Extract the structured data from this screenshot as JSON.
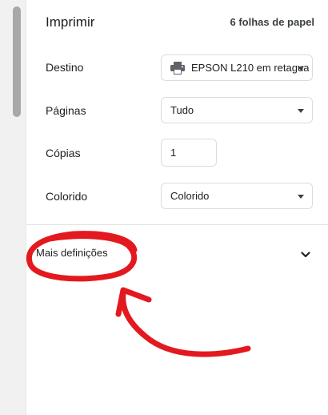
{
  "header": {
    "title": "Imprimir",
    "sheets": "6 folhas de papel"
  },
  "destination": {
    "label": "Destino",
    "value": "EPSON L210 em retagua",
    "icon": "printer-icon"
  },
  "pages": {
    "label": "Páginas",
    "value": "Tudo"
  },
  "copies": {
    "label": "Cópias",
    "value": "1"
  },
  "color": {
    "label": "Colorido",
    "value": "Colorido"
  },
  "more": {
    "label": "Mais definições",
    "icon": "chevron-down-icon"
  },
  "annotation": {
    "color": "#e3191f"
  }
}
